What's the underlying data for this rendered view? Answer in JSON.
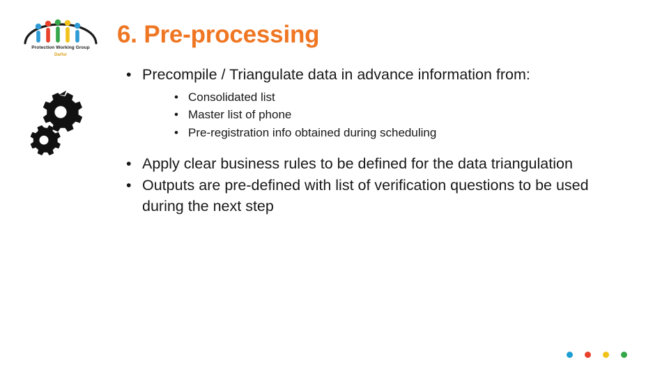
{
  "slide": {
    "title": "6. Pre-processing",
    "title_color": "#ef7622",
    "background": "#ffffff",
    "logo": {
      "caption": "Protection Working Group",
      "subcaption": "Darfur",
      "icon": "protection-working-group-logo"
    },
    "graphic": {
      "icon": "gears-icon"
    },
    "content": [
      {
        "level": 1,
        "bullet": "•",
        "text": "Precompile / Triangulate data in advance information from:",
        "children": [
          {
            "level": 2,
            "bullet": "•",
            "text": "Consolidated list"
          },
          {
            "level": 2,
            "bullet": "•",
            "text": "Master list of phone"
          },
          {
            "level": 2,
            "bullet": "•",
            "text": "Pre-registration info obtained during scheduling"
          }
        ]
      },
      {
        "level": 1,
        "bullet": "•",
        "text": "Apply clear business rules to be defined for the data triangulation",
        "children": []
      },
      {
        "level": 1,
        "bullet": "•",
        "text": "Outputs are pre-defined with list of verification questions to be used during the next step",
        "children": []
      }
    ],
    "footer_dots": [
      {
        "name": "dot-blue",
        "color": "#1f9ed4"
      },
      {
        "name": "dot-red",
        "color": "#e8412c"
      },
      {
        "name": "dot-yellow",
        "color": "#f2c21a"
      },
      {
        "name": "dot-green",
        "color": "#35a64a"
      }
    ]
  }
}
